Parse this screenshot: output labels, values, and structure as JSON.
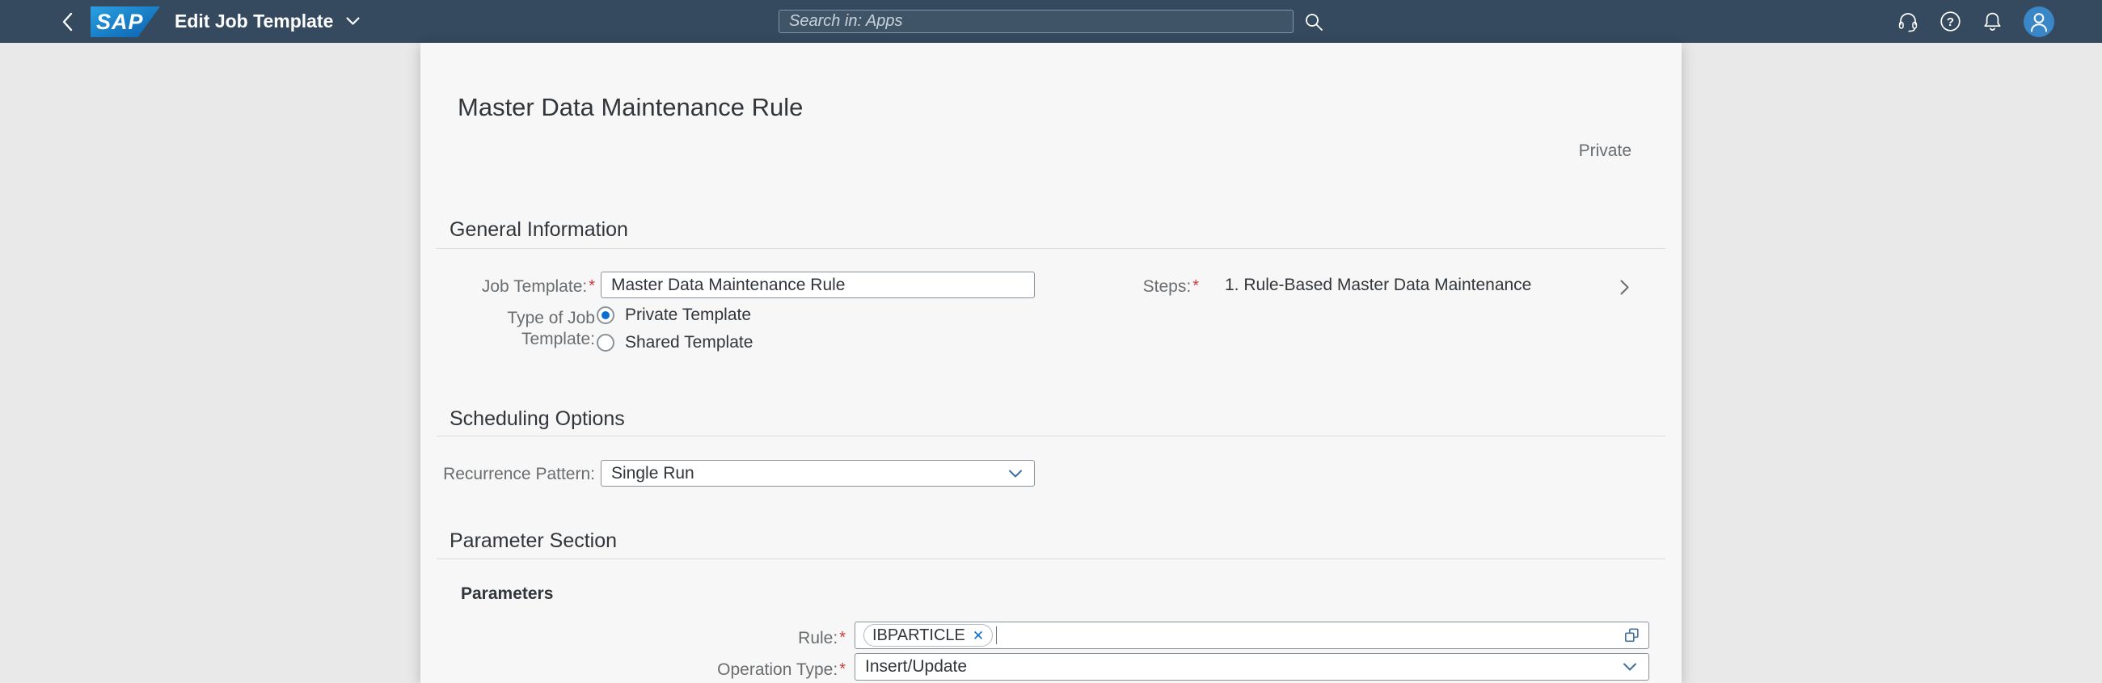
{
  "shell": {
    "logo_text": "SAP",
    "app_title": "Edit Job Template",
    "search_placeholder": "Search in: Apps",
    "help_glyph": "?"
  },
  "page": {
    "title": "Master Data Maintenance Rule",
    "privacy_badge": "Private"
  },
  "general_information": {
    "section_title": "General Information",
    "job_template": {
      "label": "Job Template:",
      "required": "*",
      "value": "Master Data Maintenance Rule"
    },
    "steps": {
      "label": "Steps:",
      "required": "*",
      "value": "1. Rule-Based Master Data Maintenance"
    },
    "type_of_job_template": {
      "label": "Type of Job Template:",
      "options": [
        {
          "label": "Private Template",
          "selected": true
        },
        {
          "label": "Shared Template",
          "selected": false
        }
      ]
    }
  },
  "scheduling_options": {
    "section_title": "Scheduling Options",
    "recurrence_pattern": {
      "label": "Recurrence Pattern:",
      "value": "Single Run"
    }
  },
  "parameter_section": {
    "section_title": "Parameter Section",
    "panel_title": "Parameters",
    "rule": {
      "label": "Rule:",
      "required": "*",
      "token": "IBPARTICLE",
      "remove_token_symbol": "✕"
    },
    "operation_type": {
      "label": "Operation Type:",
      "required": "*",
      "value": "Insert/Update"
    }
  },
  "colors": {
    "shell_background": "#354a5f",
    "accent_blue": "#0a6ed1",
    "required_red": "#ce3b3b",
    "card_background": "#f7f7f7"
  }
}
